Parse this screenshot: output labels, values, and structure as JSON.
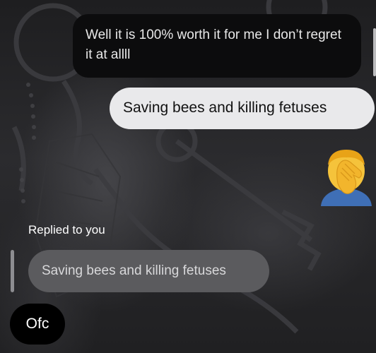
{
  "messages": {
    "sent_dark": "Well it is 100% worth it for me I don’t regret it at allll",
    "sent_light": "Saving bees and killing fetuses",
    "emoji_name": "person-facepalming",
    "reply_label": "Replied to you",
    "quoted": "Saving bees and killing fetuses",
    "reply_text": "Ofc"
  },
  "colors": {
    "dark_bubble": "#0c0c0d",
    "light_bubble": "#e9e9eb",
    "quote_bubble": "#5b5b5e"
  }
}
